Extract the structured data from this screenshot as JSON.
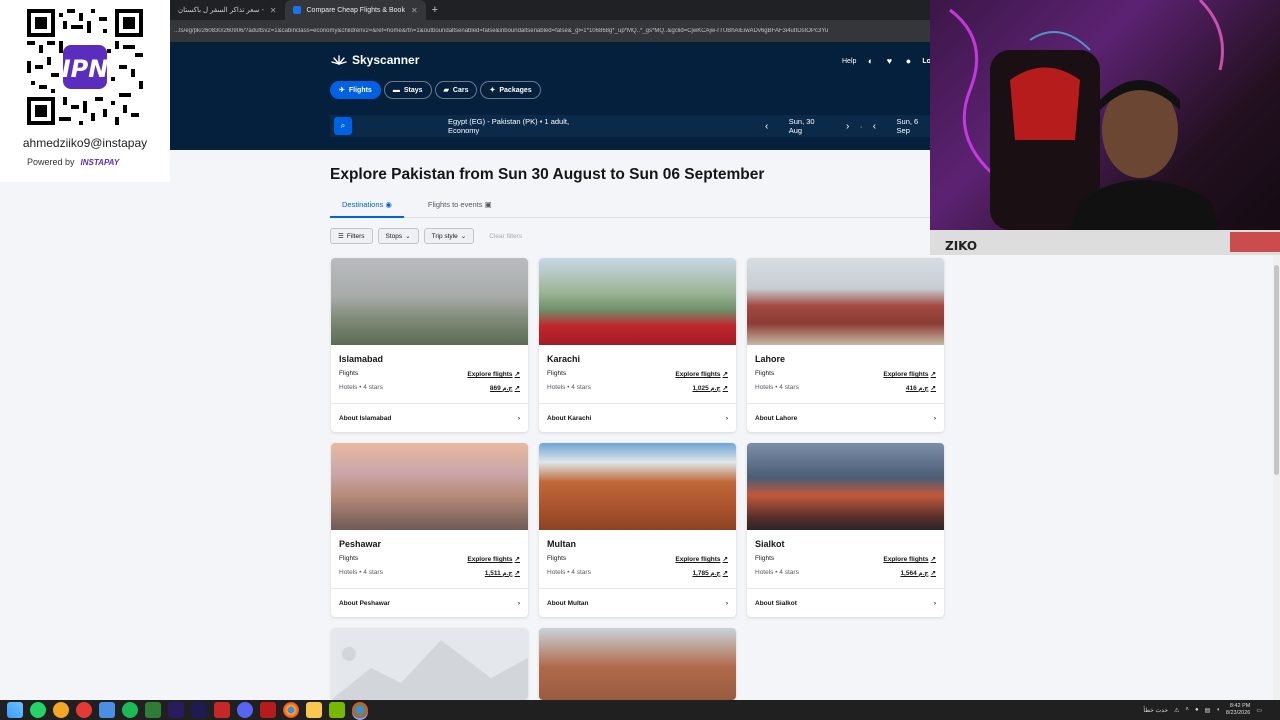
{
  "browser": {
    "tabs": [
      {
        "label": "سعر تذاكر السفر ل باكستان -"
      },
      {
        "label": "Compare Cheap Flights & Book"
      }
    ],
    "url": "...ts/eg/pk/260830/260906/?adultsv2=1&cabinclass=economy&childrenv2=&ref=home&rtn=1&outboundaltsenabled=false&inboundaltsenabled=false&_gl=1*106868g*_up*MQ..*_gs*MQ..&gclid=CjwKCAjw-rTUBhAiEiwADv6gBFAF3i4utIDsIOPc3Yu"
  },
  "header": {
    "brand": "Skyscanner",
    "help": "Help",
    "login": "Lo",
    "nav": [
      {
        "label": "Flights",
        "icon": "plane-icon",
        "active": true
      },
      {
        "label": "Stays",
        "icon": "bed-icon",
        "active": false
      },
      {
        "label": "Cars",
        "icon": "car-icon",
        "active": false
      },
      {
        "label": "Packages",
        "icon": "package-icon",
        "active": false
      }
    ],
    "search": {
      "route": "Egypt (EG) - Pakistan (PK)  •  1 adult, Economy",
      "depart": "Sun, 30 Aug",
      "return": "Sun, 6 Sep"
    }
  },
  "page": {
    "title": "Explore Pakistan from Sun 30 August to Sun 06 September",
    "tabs": [
      {
        "label": "Destinations",
        "active": true
      },
      {
        "label": "Flights to events",
        "active": false
      }
    ],
    "filters": [
      "Filters",
      "Stops",
      "Trip style"
    ],
    "clear": "Clear filters"
  },
  "cards": [
    {
      "name": "Islamabad",
      "flights": "Flights",
      "hotels": "Hotels • 4 stars",
      "explore": "Explore flights",
      "price": "869 ج.م",
      "about": "About Islamabad"
    },
    {
      "name": "Karachi",
      "flights": "Flights",
      "hotels": "Hotels • 4 stars",
      "explore": "Explore flights",
      "price": "1,025 ج.م",
      "about": "About Karachi"
    },
    {
      "name": "Lahore",
      "flights": "Flights",
      "hotels": "Hotels • 4 stars",
      "explore": "Explore flights",
      "price": "416 ج.م",
      "about": "About Lahore"
    },
    {
      "name": "Peshawar",
      "flights": "Flights",
      "hotels": "Hotels • 4 stars",
      "explore": "Explore flights",
      "price": "1,511 ج.م",
      "about": "About Peshawar"
    },
    {
      "name": "Multan",
      "flights": "Flights",
      "hotels": "Hotels • 4 stars",
      "explore": "Explore flights",
      "price": "1,785 ج.م",
      "about": "About Multan"
    },
    {
      "name": "Sialkot",
      "flights": "Flights",
      "hotels": "Hotels • 4 stars",
      "explore": "Explore flights",
      "price": "1,564 ج.م",
      "about": "About Sialkot"
    }
  ],
  "overlay": {
    "handle": "ahmedziiko9@instapay",
    "powered": "Powered by",
    "brand": "INSTAPAY"
  },
  "taskbar": {
    "tray_text": "حدث خطأ",
    "time": "8:42 PM",
    "date": "8/23/2026"
  },
  "colors": {
    "header_bg": "#05203c",
    "accent": "#0062e3",
    "page_bg": "#f3f5f8"
  }
}
